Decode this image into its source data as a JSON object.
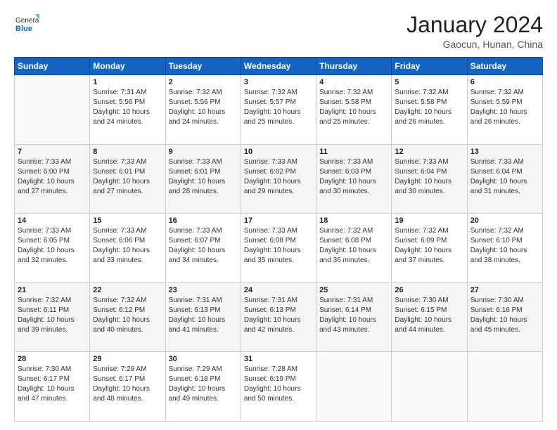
{
  "logo": {
    "general": "General",
    "blue": "Blue"
  },
  "title": "January 2024",
  "subtitle": "Gaocun, Hunan, China",
  "headers": [
    "Sunday",
    "Monday",
    "Tuesday",
    "Wednesday",
    "Thursday",
    "Friday",
    "Saturday"
  ],
  "weeks": [
    [
      {
        "day": "",
        "content": ""
      },
      {
        "day": "1",
        "content": "Sunrise: 7:31 AM\nSunset: 5:56 PM\nDaylight: 10 hours\nand 24 minutes."
      },
      {
        "day": "2",
        "content": "Sunrise: 7:32 AM\nSunset: 5:56 PM\nDaylight: 10 hours\nand 24 minutes."
      },
      {
        "day": "3",
        "content": "Sunrise: 7:32 AM\nSunset: 5:57 PM\nDaylight: 10 hours\nand 25 minutes."
      },
      {
        "day": "4",
        "content": "Sunrise: 7:32 AM\nSunset: 5:58 PM\nDaylight: 10 hours\nand 25 minutes."
      },
      {
        "day": "5",
        "content": "Sunrise: 7:32 AM\nSunset: 5:58 PM\nDaylight: 10 hours\nand 26 minutes."
      },
      {
        "day": "6",
        "content": "Sunrise: 7:32 AM\nSunset: 5:59 PM\nDaylight: 10 hours\nand 26 minutes."
      }
    ],
    [
      {
        "day": "7",
        "content": "Sunrise: 7:33 AM\nSunset: 6:00 PM\nDaylight: 10 hours\nand 27 minutes."
      },
      {
        "day": "8",
        "content": "Sunrise: 7:33 AM\nSunset: 6:01 PM\nDaylight: 10 hours\nand 27 minutes."
      },
      {
        "day": "9",
        "content": "Sunrise: 7:33 AM\nSunset: 6:01 PM\nDaylight: 10 hours\nand 28 minutes."
      },
      {
        "day": "10",
        "content": "Sunrise: 7:33 AM\nSunset: 6:02 PM\nDaylight: 10 hours\nand 29 minutes."
      },
      {
        "day": "11",
        "content": "Sunrise: 7:33 AM\nSunset: 6:03 PM\nDaylight: 10 hours\nand 30 minutes."
      },
      {
        "day": "12",
        "content": "Sunrise: 7:33 AM\nSunset: 6:04 PM\nDaylight: 10 hours\nand 30 minutes."
      },
      {
        "day": "13",
        "content": "Sunrise: 7:33 AM\nSunset: 6:04 PM\nDaylight: 10 hours\nand 31 minutes."
      }
    ],
    [
      {
        "day": "14",
        "content": "Sunrise: 7:33 AM\nSunset: 6:05 PM\nDaylight: 10 hours\nand 32 minutes."
      },
      {
        "day": "15",
        "content": "Sunrise: 7:33 AM\nSunset: 6:06 PM\nDaylight: 10 hours\nand 33 minutes."
      },
      {
        "day": "16",
        "content": "Sunrise: 7:33 AM\nSunset: 6:07 PM\nDaylight: 10 hours\nand 34 minutes."
      },
      {
        "day": "17",
        "content": "Sunrise: 7:33 AM\nSunset: 6:08 PM\nDaylight: 10 hours\nand 35 minutes."
      },
      {
        "day": "18",
        "content": "Sunrise: 7:32 AM\nSunset: 6:08 PM\nDaylight: 10 hours\nand 36 minutes."
      },
      {
        "day": "19",
        "content": "Sunrise: 7:32 AM\nSunset: 6:09 PM\nDaylight: 10 hours\nand 37 minutes."
      },
      {
        "day": "20",
        "content": "Sunrise: 7:32 AM\nSunset: 6:10 PM\nDaylight: 10 hours\nand 38 minutes."
      }
    ],
    [
      {
        "day": "21",
        "content": "Sunrise: 7:32 AM\nSunset: 6:11 PM\nDaylight: 10 hours\nand 39 minutes."
      },
      {
        "day": "22",
        "content": "Sunrise: 7:32 AM\nSunset: 6:12 PM\nDaylight: 10 hours\nand 40 minutes."
      },
      {
        "day": "23",
        "content": "Sunrise: 7:31 AM\nSunset: 6:13 PM\nDaylight: 10 hours\nand 41 minutes."
      },
      {
        "day": "24",
        "content": "Sunrise: 7:31 AM\nSunset: 6:13 PM\nDaylight: 10 hours\nand 42 minutes."
      },
      {
        "day": "25",
        "content": "Sunrise: 7:31 AM\nSunset: 6:14 PM\nDaylight: 10 hours\nand 43 minutes."
      },
      {
        "day": "26",
        "content": "Sunrise: 7:30 AM\nSunset: 6:15 PM\nDaylight: 10 hours\nand 44 minutes."
      },
      {
        "day": "27",
        "content": "Sunrise: 7:30 AM\nSunset: 6:16 PM\nDaylight: 10 hours\nand 45 minutes."
      }
    ],
    [
      {
        "day": "28",
        "content": "Sunrise: 7:30 AM\nSunset: 6:17 PM\nDaylight: 10 hours\nand 47 minutes."
      },
      {
        "day": "29",
        "content": "Sunrise: 7:29 AM\nSunset: 6:17 PM\nDaylight: 10 hours\nand 48 minutes."
      },
      {
        "day": "30",
        "content": "Sunrise: 7:29 AM\nSunset: 6:18 PM\nDaylight: 10 hours\nand 49 minutes."
      },
      {
        "day": "31",
        "content": "Sunrise: 7:28 AM\nSunset: 6:19 PM\nDaylight: 10 hours\nand 50 minutes."
      },
      {
        "day": "",
        "content": ""
      },
      {
        "day": "",
        "content": ""
      },
      {
        "day": "",
        "content": ""
      }
    ]
  ]
}
